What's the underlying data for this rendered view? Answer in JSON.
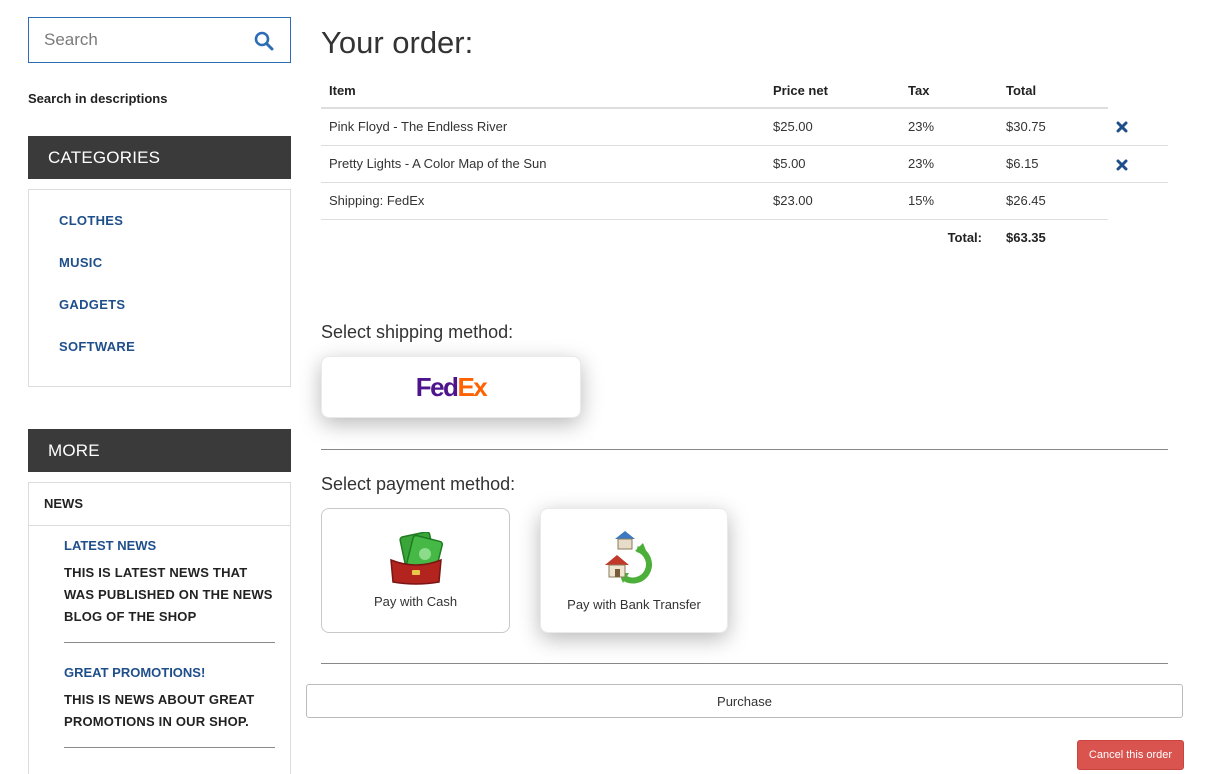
{
  "sidebar": {
    "search": {
      "placeholder": "Search",
      "value": ""
    },
    "search_desc_label": "Search in descriptions",
    "categories_title": "CATEGORIES",
    "categories": [
      "CLOTHES",
      "MUSIC",
      "GADGETS",
      "SOFTWARE"
    ],
    "more_title": "MORE",
    "news_heading": "NEWS",
    "news": [
      {
        "title": "LATEST NEWS",
        "text": "THIS IS LATEST NEWS THAT WAS PUBLISHED ON THE NEWS BLOG OF THE SHOP"
      },
      {
        "title": "GREAT PROMOTIONS!",
        "text": "THIS IS NEWS ABOUT GREAT PROMOTIONS IN OUR SHOP."
      }
    ]
  },
  "order": {
    "title": "Your order:",
    "columns": {
      "item": "Item",
      "price_net": "Price net",
      "tax": "Tax",
      "total": "Total"
    },
    "rows": [
      {
        "item": "Pink Floyd - The Endless River",
        "price_net": "$25.00",
        "tax": "23%",
        "total": "$30.75",
        "removable": true
      },
      {
        "item": "Pretty Lights - A Color Map of the Sun",
        "price_net": "$5.00",
        "tax": "23%",
        "total": "$6.15",
        "removable": true
      },
      {
        "item": "Shipping: FedEx",
        "price_net": "$23.00",
        "tax": "15%",
        "total": "$26.45",
        "removable": false
      }
    ],
    "total_label": "Total:",
    "total_value": "$63.35"
  },
  "shipping": {
    "title": "Select shipping method:",
    "options": [
      {
        "logo_fed": "Fed",
        "logo_ex": "Ex",
        "selected": true
      }
    ]
  },
  "payment": {
    "title": "Select payment method:",
    "options": [
      {
        "label": "Pay with Cash",
        "icon": "cash-icon",
        "selected": false
      },
      {
        "label": "Pay with Bank Transfer",
        "icon": "bank-transfer-icon",
        "selected": true
      }
    ]
  },
  "actions": {
    "purchase_label": "Purchase",
    "cancel_label": "Cancel this order"
  },
  "colors": {
    "brand_blue": "#1f4f8a",
    "panel_dark": "#3a3a3a",
    "cancel_red": "#d9534f",
    "fedex_purple": "#4d148c",
    "fedex_orange": "#ff6200"
  }
}
